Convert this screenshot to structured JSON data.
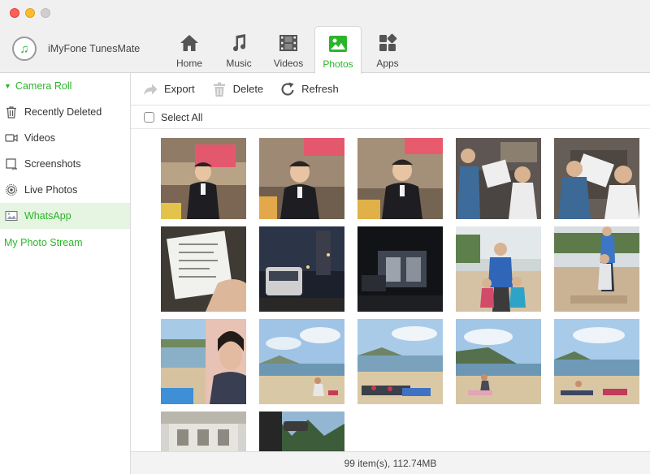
{
  "app": {
    "name": "iMyFone TunesMate"
  },
  "nav": {
    "tabs": [
      {
        "label": "Home",
        "icon": "home-icon"
      },
      {
        "label": "Music",
        "icon": "music-note-icon"
      },
      {
        "label": "Videos",
        "icon": "film-icon"
      },
      {
        "label": "Photos",
        "icon": "photo-icon",
        "active": true
      },
      {
        "label": "Apps",
        "icon": "apps-icon"
      }
    ]
  },
  "sidebar": {
    "group": "Camera Roll",
    "items": [
      {
        "label": "Recently Deleted",
        "icon": "trash-icon"
      },
      {
        "label": "Videos",
        "icon": "video-camera-icon"
      },
      {
        "label": "Screenshots",
        "icon": "screenshot-icon"
      },
      {
        "label": "Live Photos",
        "icon": "live-photo-icon"
      },
      {
        "label": "WhatsApp",
        "icon": "image-icon",
        "active": true
      }
    ],
    "stream": "My Photo Stream"
  },
  "toolbar": {
    "export": "Export",
    "delete": "Delete",
    "refresh": "Refresh"
  },
  "select_all": "Select All",
  "status": "99 item(s), 112.74MB",
  "colors": {
    "accent": "#2bb52b",
    "active_bg": "#e6f4e2"
  }
}
